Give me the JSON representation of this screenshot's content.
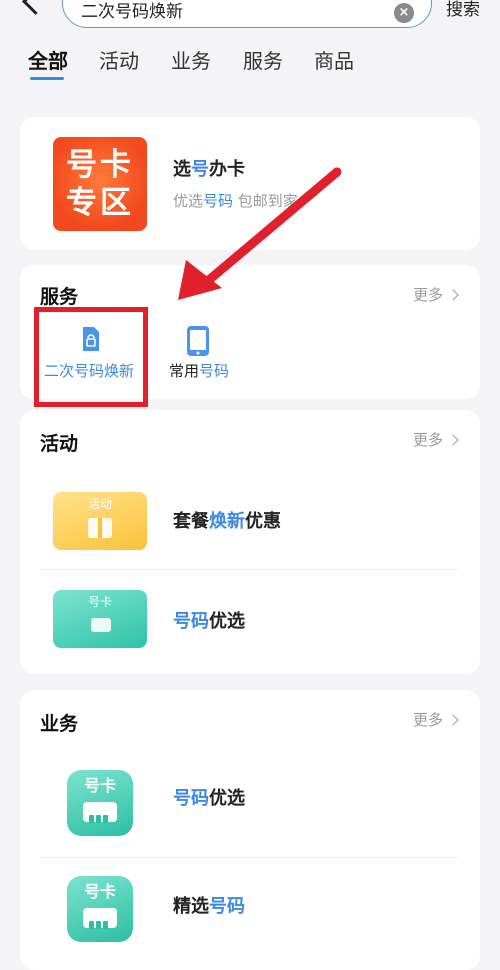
{
  "header": {
    "search_value": "二次号码焕新",
    "search_button": "搜索"
  },
  "tabs": [
    {
      "label": "全部",
      "active": true
    },
    {
      "label": "活动",
      "active": false
    },
    {
      "label": "业务",
      "active": false
    },
    {
      "label": "服务",
      "active": false
    },
    {
      "label": "商品",
      "active": false
    }
  ],
  "banner": {
    "tile_line1": "号卡",
    "tile_line2": "专区",
    "title_a": "选",
    "title_b": "号",
    "title_c": "办卡",
    "subtitle_a": "优选",
    "subtitle_b": "号码",
    "subtitle_c": " 包邮到家"
  },
  "service_section": {
    "title": "服务",
    "more": "更多",
    "items": [
      {
        "label": "二次号码焕新",
        "icon": "sim-renew-icon"
      },
      {
        "label_a": "常用",
        "label_b": "号码",
        "icon": "phone-icon"
      }
    ]
  },
  "activity_section": {
    "title": "活动",
    "more": "更多",
    "items": [
      {
        "image_label": "活动",
        "title_a": "套餐",
        "title_b": "焕新",
        "title_c": "优惠"
      },
      {
        "image_label": "号卡",
        "title_a": "号码",
        "title_b": "优选"
      }
    ]
  },
  "business_section": {
    "title": "业务",
    "more": "更多",
    "items": [
      {
        "image_label": "号卡",
        "title_a": "号码",
        "title_b": "优选"
      },
      {
        "image_label": "号卡",
        "title_a": "精选",
        "title_b": "号码"
      }
    ]
  },
  "colors": {
    "accent": "#3b88e8",
    "annotation": "#e0212b",
    "background": "#f4f4f6"
  }
}
